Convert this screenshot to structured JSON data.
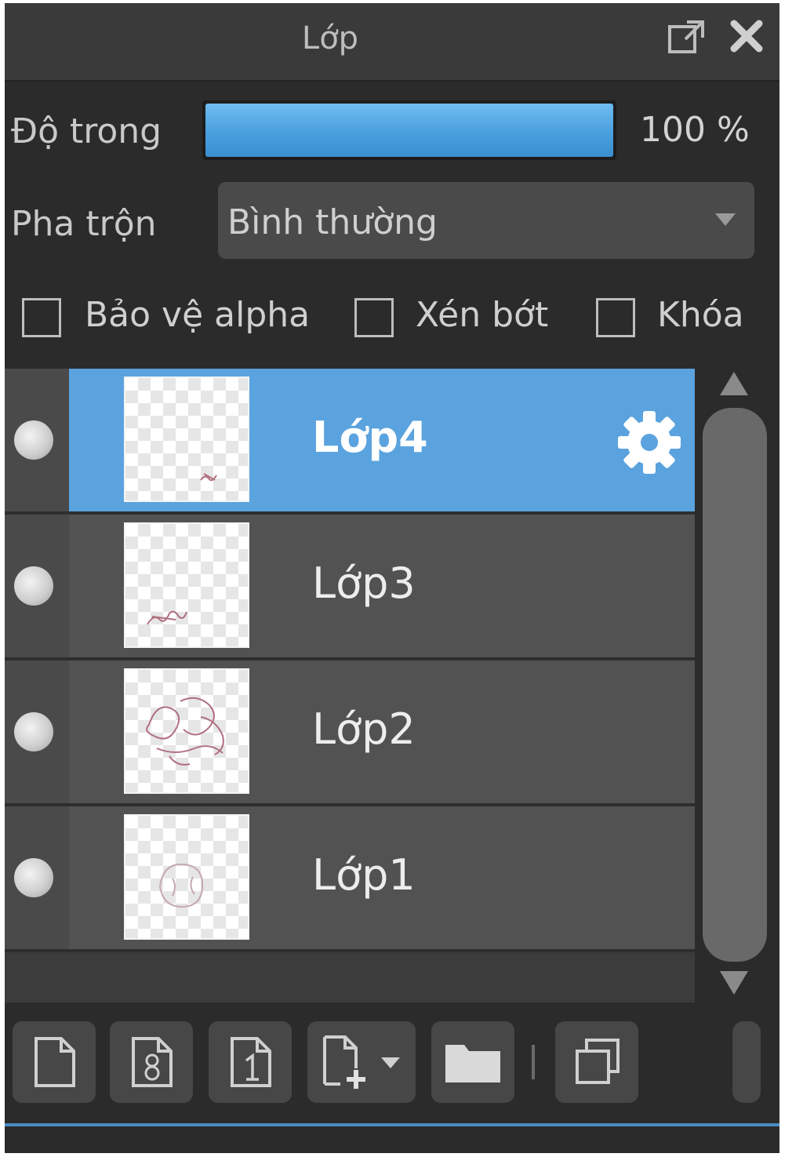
{
  "panel": {
    "title": "Lớp"
  },
  "opacity": {
    "label": "Độ trong",
    "value_text": "100 %",
    "value": 1.0
  },
  "blend": {
    "label": "Pha trộn",
    "value": "Bình thường"
  },
  "options": [
    {
      "label": "Bảo vệ alpha",
      "checked": false
    },
    {
      "label": "Xén bớt",
      "checked": false
    },
    {
      "label": "Khóa",
      "checked": false
    }
  ],
  "layers": [
    {
      "name": "Lớp4",
      "selected": true,
      "visible": true
    },
    {
      "name": "Lớp3",
      "selected": false,
      "visible": true
    },
    {
      "name": "Lớp2",
      "selected": false,
      "visible": true
    },
    {
      "name": "Lớp1",
      "selected": false,
      "visible": true
    }
  ],
  "toolbar": {
    "buttons": [
      {
        "icon": "new-layer-icon"
      },
      {
        "icon": "new-8bit-layer-icon"
      },
      {
        "icon": "new-1bit-layer-icon"
      },
      {
        "icon": "add-layer-menu-icon"
      },
      {
        "icon": "folder-icon"
      },
      {
        "icon": "duplicate-layer-icon"
      }
    ]
  },
  "colors": {
    "accent": "#5ba3de",
    "panel_bg": "#2b2b2b",
    "layer_bg": "#525252"
  }
}
